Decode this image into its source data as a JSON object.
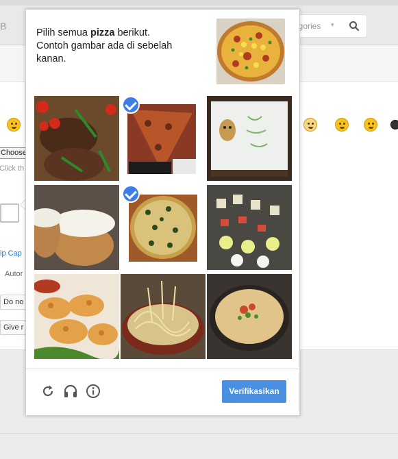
{
  "background": {
    "top_fragment": "B",
    "search": {
      "categories_label": "egories",
      "caret": "▾"
    },
    "choose_label": "Choose",
    "click_hint": "Click th",
    "link_text": "ip Cap",
    "auto_text": "Autor",
    "do_not_label": "Do no",
    "give_label": "Give r"
  },
  "captcha": {
    "prompt_before": "Pilih semua",
    "prompt_keyword": "pizza",
    "prompt_after": "berikut.",
    "prompt_line2": "Contoh gambar ada di sebelah kanan.",
    "tiles": [
      {
        "subject": "grilled steak with tomatoes",
        "selected": false
      },
      {
        "subject": "pizza slice",
        "selected": true
      },
      {
        "subject": "dog birthday cake",
        "selected": false
      },
      {
        "subject": "cream buns",
        "selected": false
      },
      {
        "subject": "pizza",
        "selected": true
      },
      {
        "subject": "desserts tray",
        "selected": false
      },
      {
        "subject": "fried shrimp",
        "selected": false
      },
      {
        "subject": "noodles",
        "selected": false
      },
      {
        "subject": "ramen bowl",
        "selected": false
      }
    ],
    "footer": {
      "reload_icon": "reload-icon",
      "audio_icon": "headphones-icon",
      "info_icon": "info-icon",
      "verify_label": "Verifikasikan",
      "verify_color": "#4a90e2"
    }
  }
}
